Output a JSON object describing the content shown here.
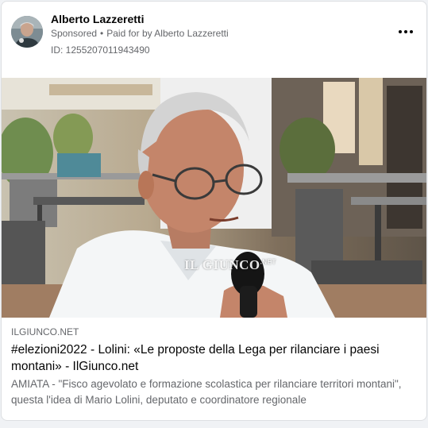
{
  "post": {
    "author": "Alberto Lazzeretti",
    "sponsored_label": "Sponsored",
    "dot": "•",
    "paid_for_prefix": "Paid for by",
    "payer": "Alberto Lazzeretti",
    "ad_id": "ID: 1255207011943490",
    "more_icon": "more-options-icon"
  },
  "image": {
    "watermark": "IL GIUNCO",
    "watermark_sup": ".NET"
  },
  "link_preview": {
    "domain": "ILGIUNCO.NET",
    "title": "#elezioni2022 - Lolini: «Le proposte della Lega per rilanciare i paesi montani» - IlGiunco.net",
    "description": "AMIATA - \"Fisco agevolato e formazione scolastica per rilanciare territori montani\", questa l'idea di Mario Lolini, deputato e coordinatore regionale"
  },
  "colors": {
    "primary_text": "#050505",
    "secondary_text": "#65676b",
    "card_border": "#dddfe2"
  }
}
